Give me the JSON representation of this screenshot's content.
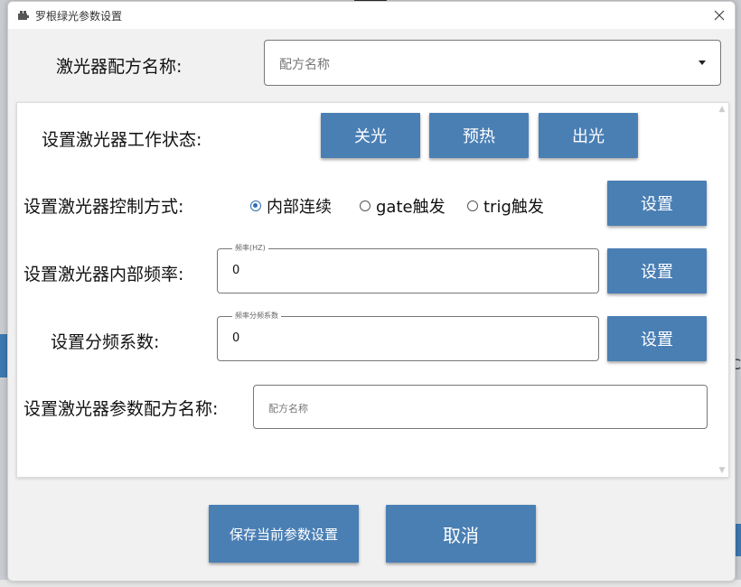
{
  "window": {
    "title": "罗根绿光参数设置"
  },
  "recipe_name": {
    "label": "激光器配方名称:",
    "placeholder": "配方名称"
  },
  "work_state": {
    "label": "设置激光器工作状态:",
    "buttons": [
      "关光",
      "预热",
      "出光"
    ]
  },
  "control_mode": {
    "label": "设置激光器控制方式:",
    "options": [
      "内部连续",
      "gate触发",
      "trig触发"
    ],
    "selected": "内部连续",
    "set_label": "设置"
  },
  "frequency": {
    "label": "设置激光器内部频率:",
    "legend": "频率(HZ)",
    "value": "0",
    "set_label": "设置"
  },
  "division": {
    "label": "设置分频系数:",
    "legend": "频率分频系数",
    "value": "0",
    "set_label": "设置"
  },
  "param_recipe": {
    "label": "设置激光器参数配方名称:",
    "placeholder": "配方名称"
  },
  "footer": {
    "save_label": "保存当前参数设置",
    "cancel_label": "取消"
  },
  "colors": {
    "accent": "#4a7fb4",
    "radio_selected": "#2f6fb5"
  }
}
